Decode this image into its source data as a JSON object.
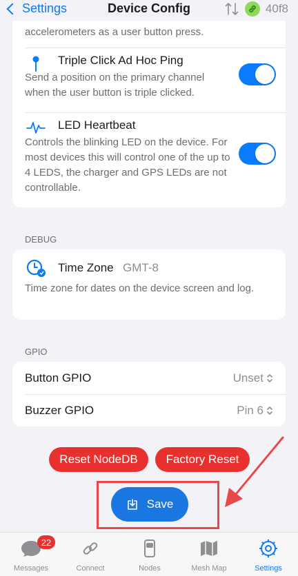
{
  "nav": {
    "back_label": "Settings",
    "title": "Device Config",
    "node_id": "40f8"
  },
  "device_card": {
    "partial_desc": "accelerometers as a user button press.",
    "triple_click": {
      "title": "Triple Click Ad Hoc Ping",
      "desc": "Send a position on the primary channel when the user button is triple clicked.",
      "enabled": true
    },
    "led_heartbeat": {
      "title": "LED Heartbeat",
      "desc": "Controls the blinking LED on the device. For most devices this will control one of the up to 4 LEDS, the charger and GPS LEDs are not controllable.",
      "enabled": true
    }
  },
  "debug": {
    "header": "DEBUG",
    "time_zone_label": "Time Zone",
    "time_zone_value": "GMT-8",
    "desc": "Time zone for dates on the device screen and log."
  },
  "gpio": {
    "header": "GPIO",
    "button_label": "Button GPIO",
    "button_value": "Unset",
    "buzzer_label": "Buzzer GPIO",
    "buzzer_value": "Pin 6"
  },
  "actions": {
    "reset_nodedb": "Reset NodeDB",
    "factory_reset": "Factory Reset",
    "save": "Save"
  },
  "colors": {
    "accent": "#0a7aff",
    "destructive": "#e8312f",
    "save": "#1a76e0",
    "highlight": "#e9484a"
  },
  "tabs": [
    {
      "label": "Messages",
      "icon": "messages-icon",
      "badge": "22"
    },
    {
      "label": "Connect",
      "icon": "link-icon"
    },
    {
      "label": "Nodes",
      "icon": "device-icon"
    },
    {
      "label": "Mesh Map",
      "icon": "map-icon"
    },
    {
      "label": "Settings",
      "icon": "gear-icon",
      "active": true
    }
  ]
}
